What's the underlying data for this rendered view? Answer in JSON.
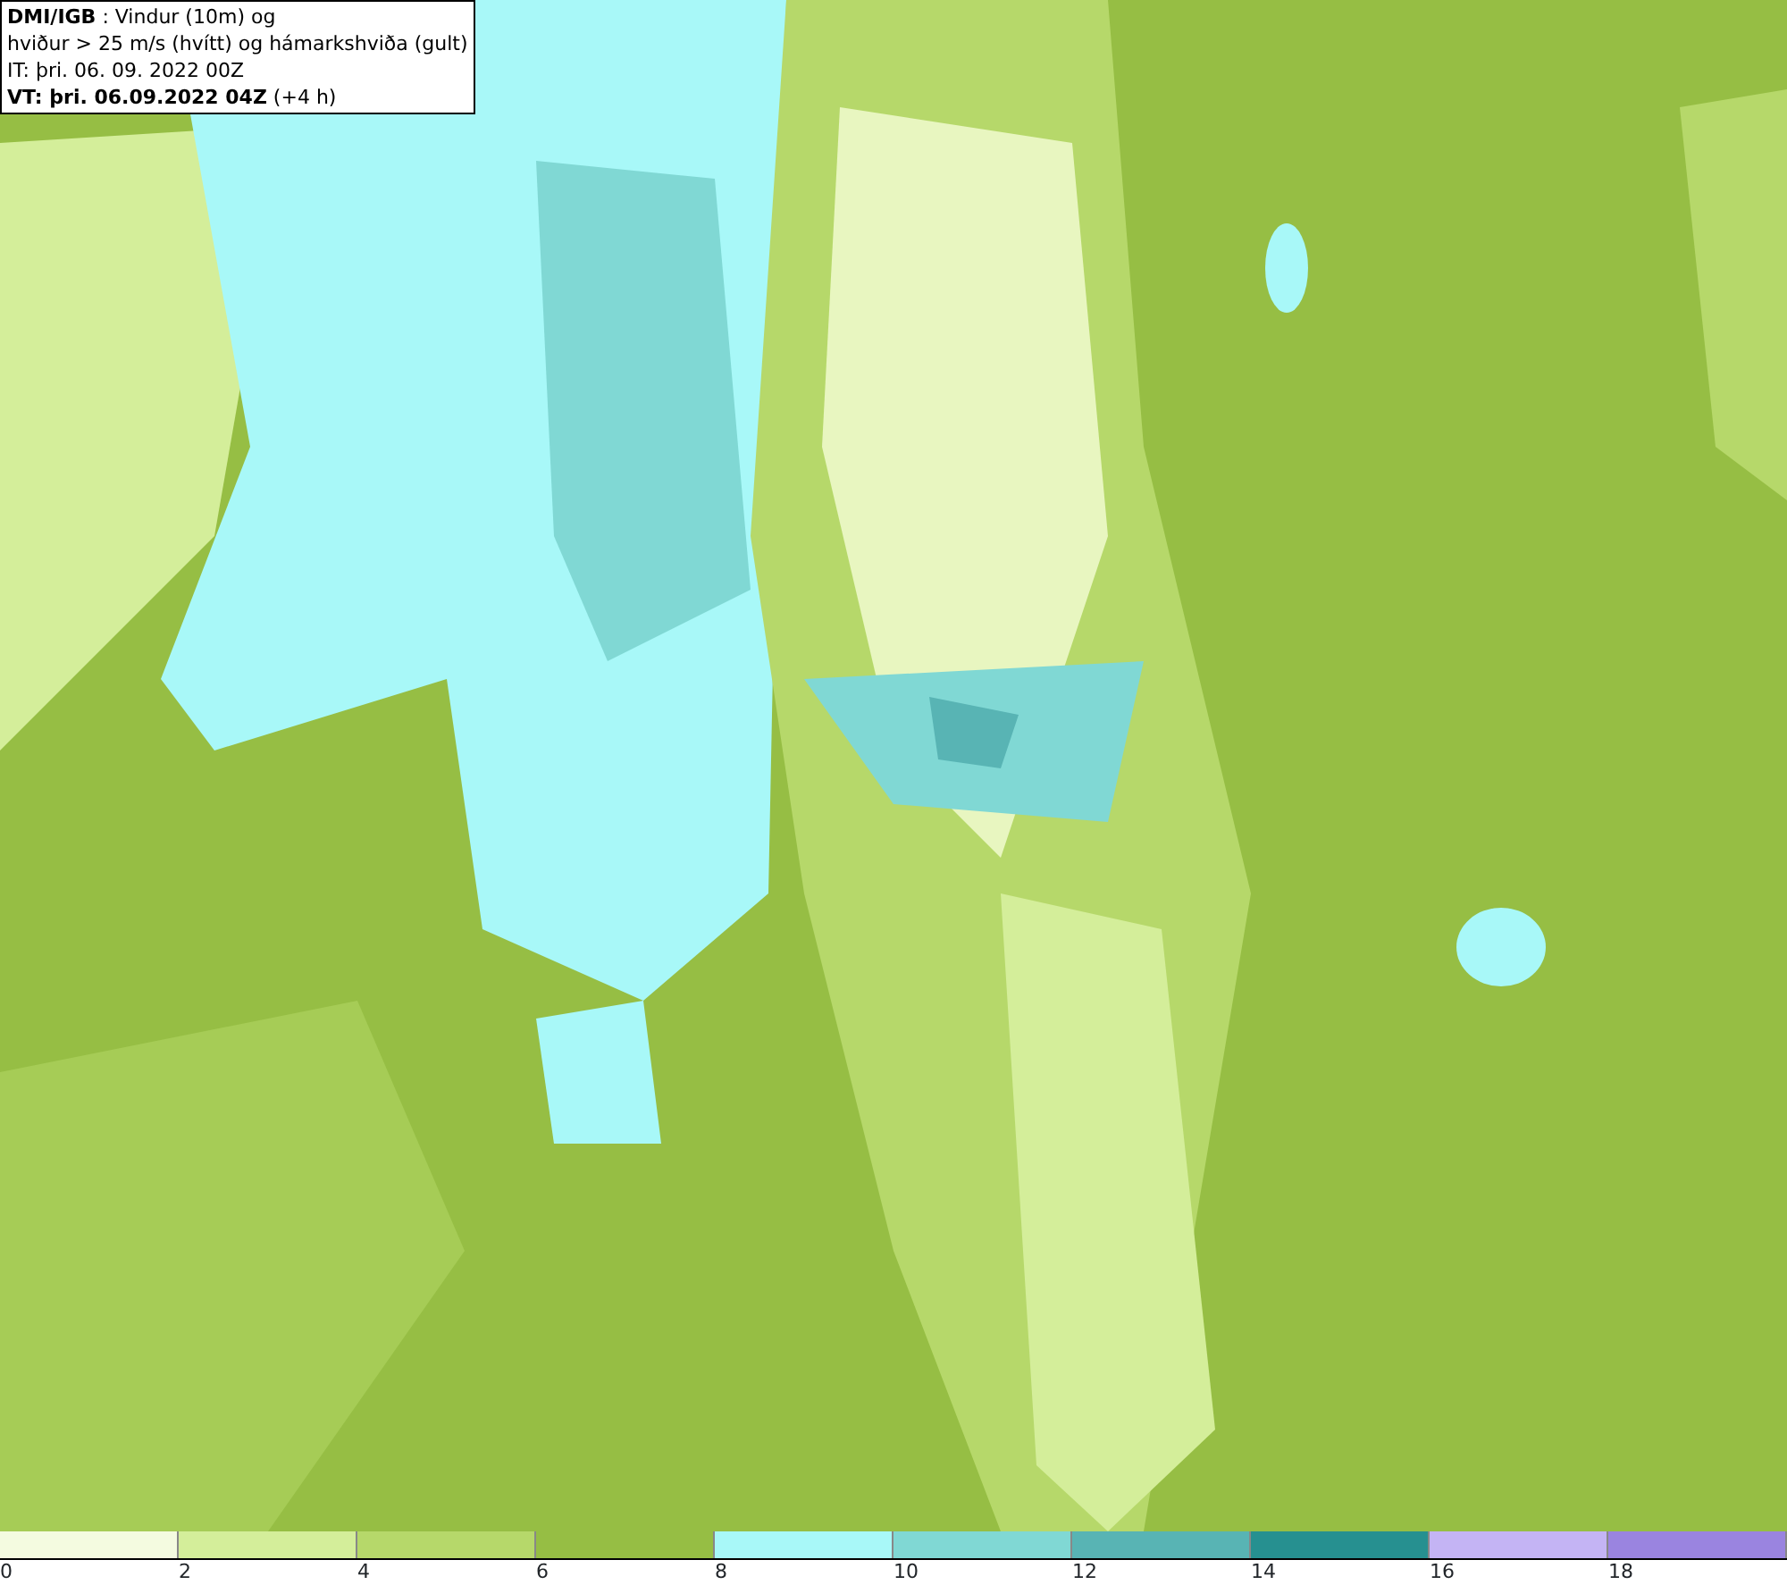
{
  "info_box": {
    "lines": [
      "**DMI/IGB** : Vindur (10m) og",
      "hviður > 25 m/s (hvítt) og hámarkshviða (gult)",
      "IT: þri. 06. 09. 2022 00Z",
      "**VT: þri. 06.09.2022 04Z** (+4 h)"
    ]
  },
  "color_scale": {
    "bins": [
      {
        "label": "0",
        "color": "#f4fbe0"
      },
      {
        "label": "2",
        "color": "#d4ee9a"
      },
      {
        "label": "4",
        "color": "#b6d86a"
      },
      {
        "label": "6",
        "color": "#96be44"
      },
      {
        "label": "8",
        "color": "#a8f8f8"
      },
      {
        "label": "10",
        "color": "#80d8d4"
      },
      {
        "label": "12",
        "color": "#58b4b4"
      },
      {
        "label": "14",
        "color": "#269090"
      },
      {
        "label": "16",
        "color": "#c4b4f4"
      },
      {
        "label": "18",
        "color": "#9a84e0"
      }
    ]
  }
}
